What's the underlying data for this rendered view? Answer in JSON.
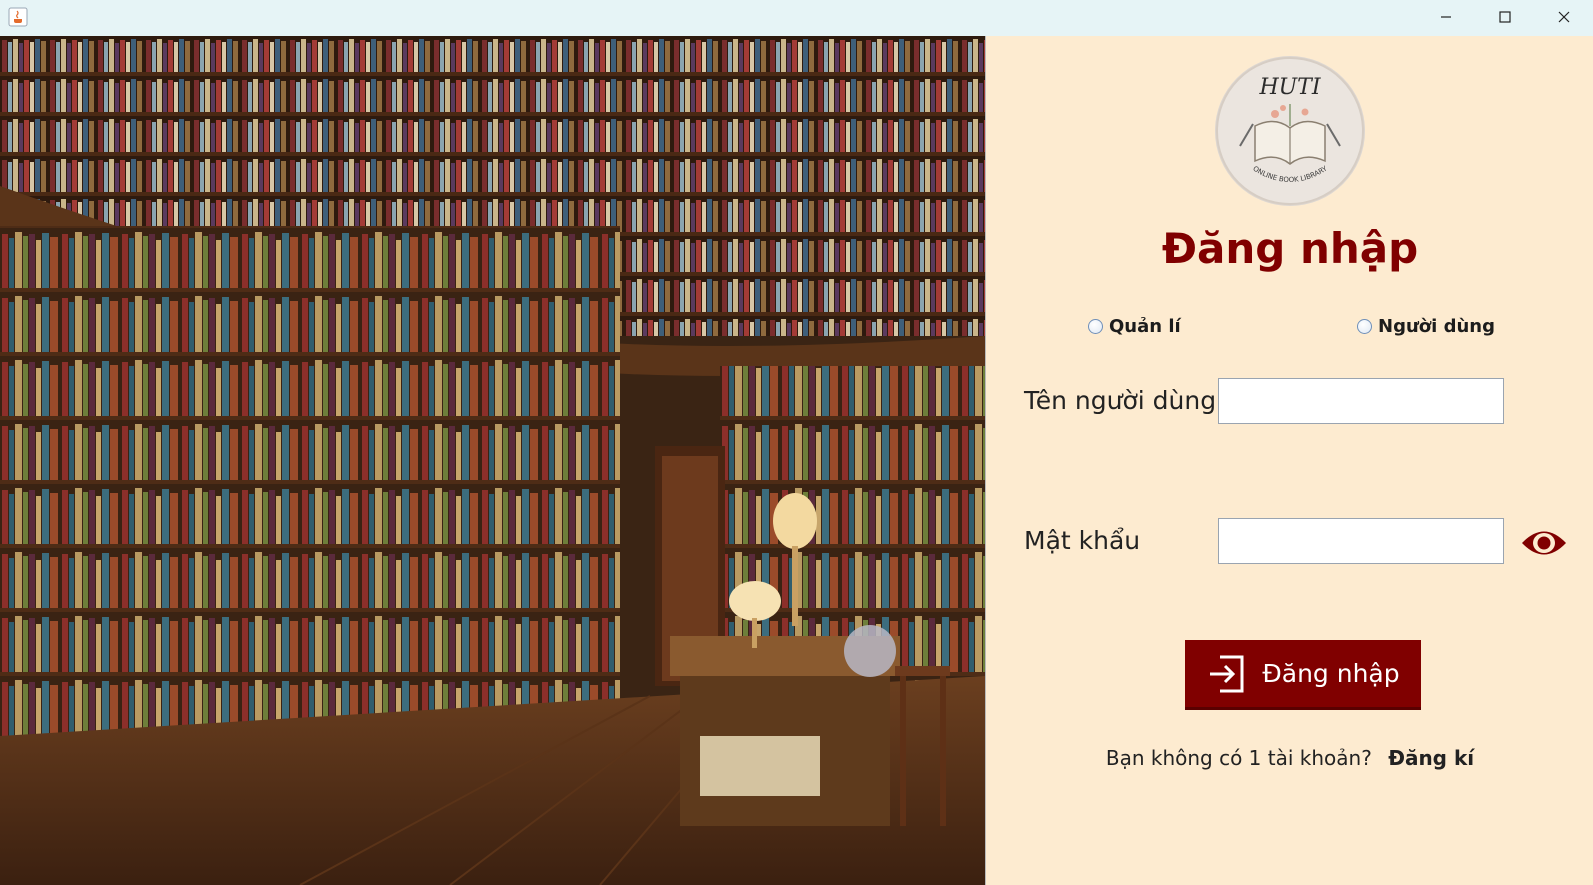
{
  "window": {
    "minimize_icon": "minimize-icon",
    "maximize_icon": "maximize-icon",
    "close_icon": "close-icon"
  },
  "logo": {
    "text": "HUTI",
    "subtitle": "ONLINE BOOK LIBRARY"
  },
  "login": {
    "title": "Đăng nhập",
    "roles": [
      {
        "label": "Quản lí",
        "selected": false
      },
      {
        "label": "Người dùng",
        "selected": false
      }
    ],
    "username_label": "Tên người dùng",
    "username_value": "",
    "password_label": "Mật khẩu",
    "password_value": "",
    "show_password_icon": "eye-icon",
    "submit_label": "Đăng nhập",
    "submit_icon": "login-icon",
    "no_account_text": "Bạn không có 1 tài khoản?",
    "signup_link": "Đăng kí"
  },
  "colors": {
    "accent": "#800000",
    "panel_bg": "#fdebd0",
    "titlebar_bg": "#e6f4f6"
  }
}
